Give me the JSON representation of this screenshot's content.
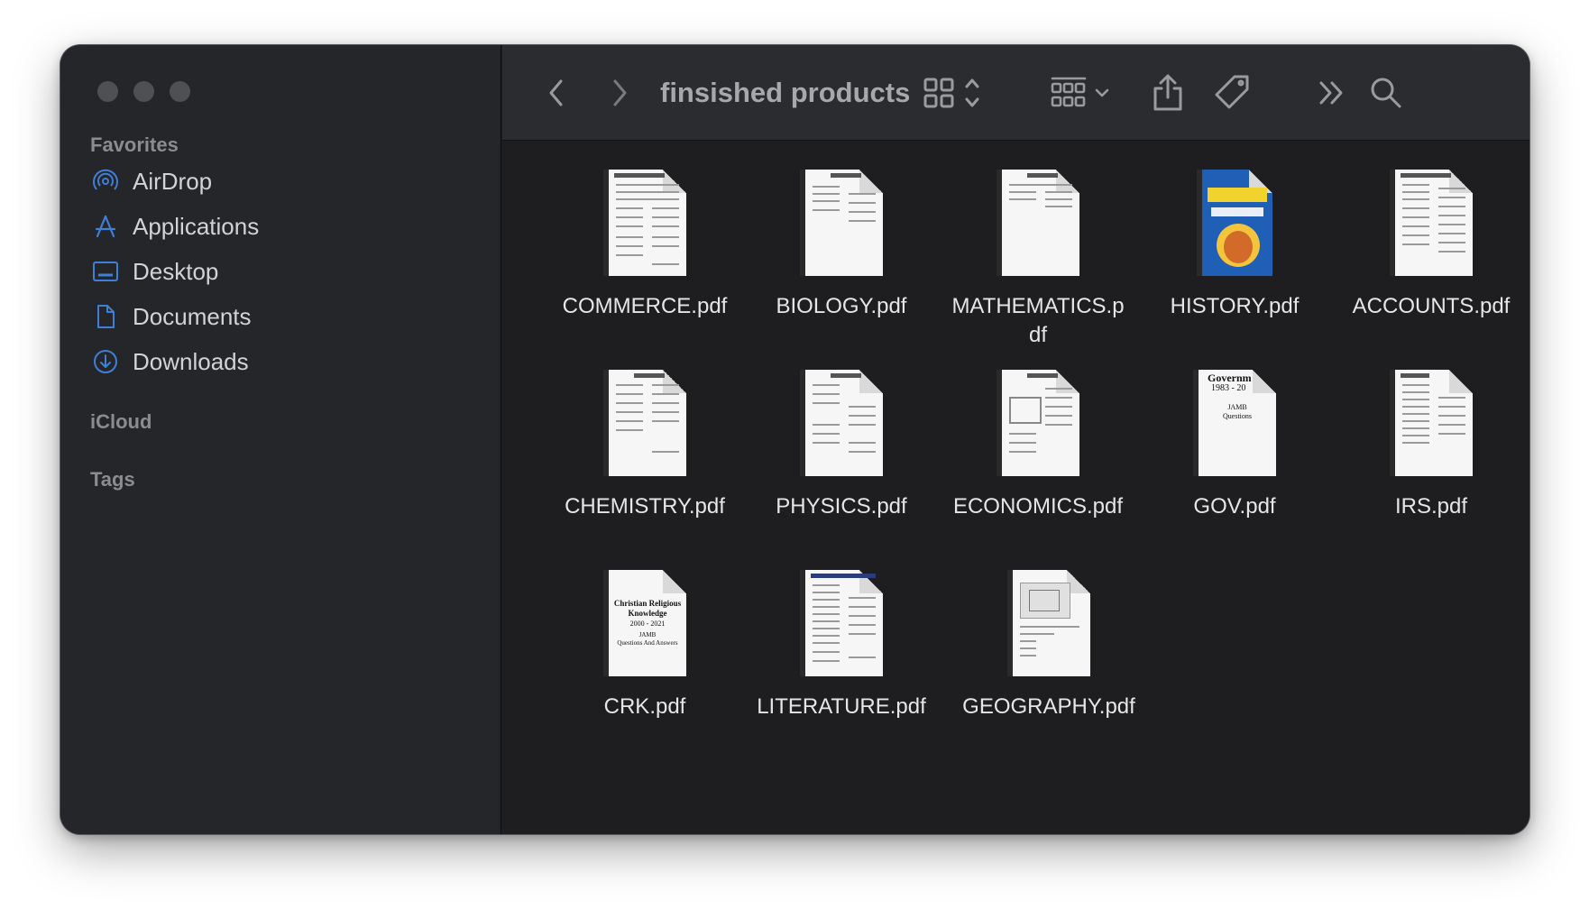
{
  "window": {
    "title": "finsished products"
  },
  "sidebar": {
    "favorites_label": "Favorites",
    "items": [
      {
        "label": "AirDrop",
        "icon": "airdrop-icon"
      },
      {
        "label": "Applications",
        "icon": "applications-icon"
      },
      {
        "label": "Desktop",
        "icon": "desktop-icon"
      },
      {
        "label": "Documents",
        "icon": "document-icon"
      },
      {
        "label": "Downloads",
        "icon": "downloads-icon"
      }
    ],
    "icloud_label": "iCloud",
    "tags_label": "Tags"
  },
  "toolbar": {
    "back_icon": "chevron-left-icon",
    "forward_icon": "chevron-right-icon",
    "view_icon": "grid-view-icon",
    "group_icon": "group-icon",
    "share_icon": "share-icon",
    "tag_icon": "tag-icon",
    "more_icon": "double-chevron-icon",
    "search_icon": "search-icon"
  },
  "files": [
    {
      "name": "COMMERCE.pdf"
    },
    {
      "name": "BIOLOGY.pdf"
    },
    {
      "name": "MATHEMATICS.pdf",
      "display": "MATHEMATICS.p df"
    },
    {
      "name": "HISTORY.pdf"
    },
    {
      "name": "ACCOUNTS.pdf"
    },
    {
      "name": "CHEMISTRY.pdf"
    },
    {
      "name": "PHYSICS.pdf"
    },
    {
      "name": "ECONOMICS.pdf"
    },
    {
      "name": "GOV.pdf"
    },
    {
      "name": "IRS.pdf"
    },
    {
      "name": "CRK.pdf"
    },
    {
      "name": "LITERATURE.pdf"
    },
    {
      "name": "GEOGRAPHY.pdf"
    }
  ],
  "thumb_text": {
    "gov_line1": "Governm",
    "gov_line2": "1983 - 20",
    "gov_line3": "JAMB",
    "gov_line4": "Questions",
    "crk_line1": "Christian Religious",
    "crk_line2": "Knowledge",
    "crk_line3": "2000 - 2021",
    "crk_line4": "JAMB",
    "crk_line5": "Questions And Answers"
  },
  "colors": {
    "accent": "#3b82f6",
    "sidebar_icon": "#3f7fd6"
  }
}
